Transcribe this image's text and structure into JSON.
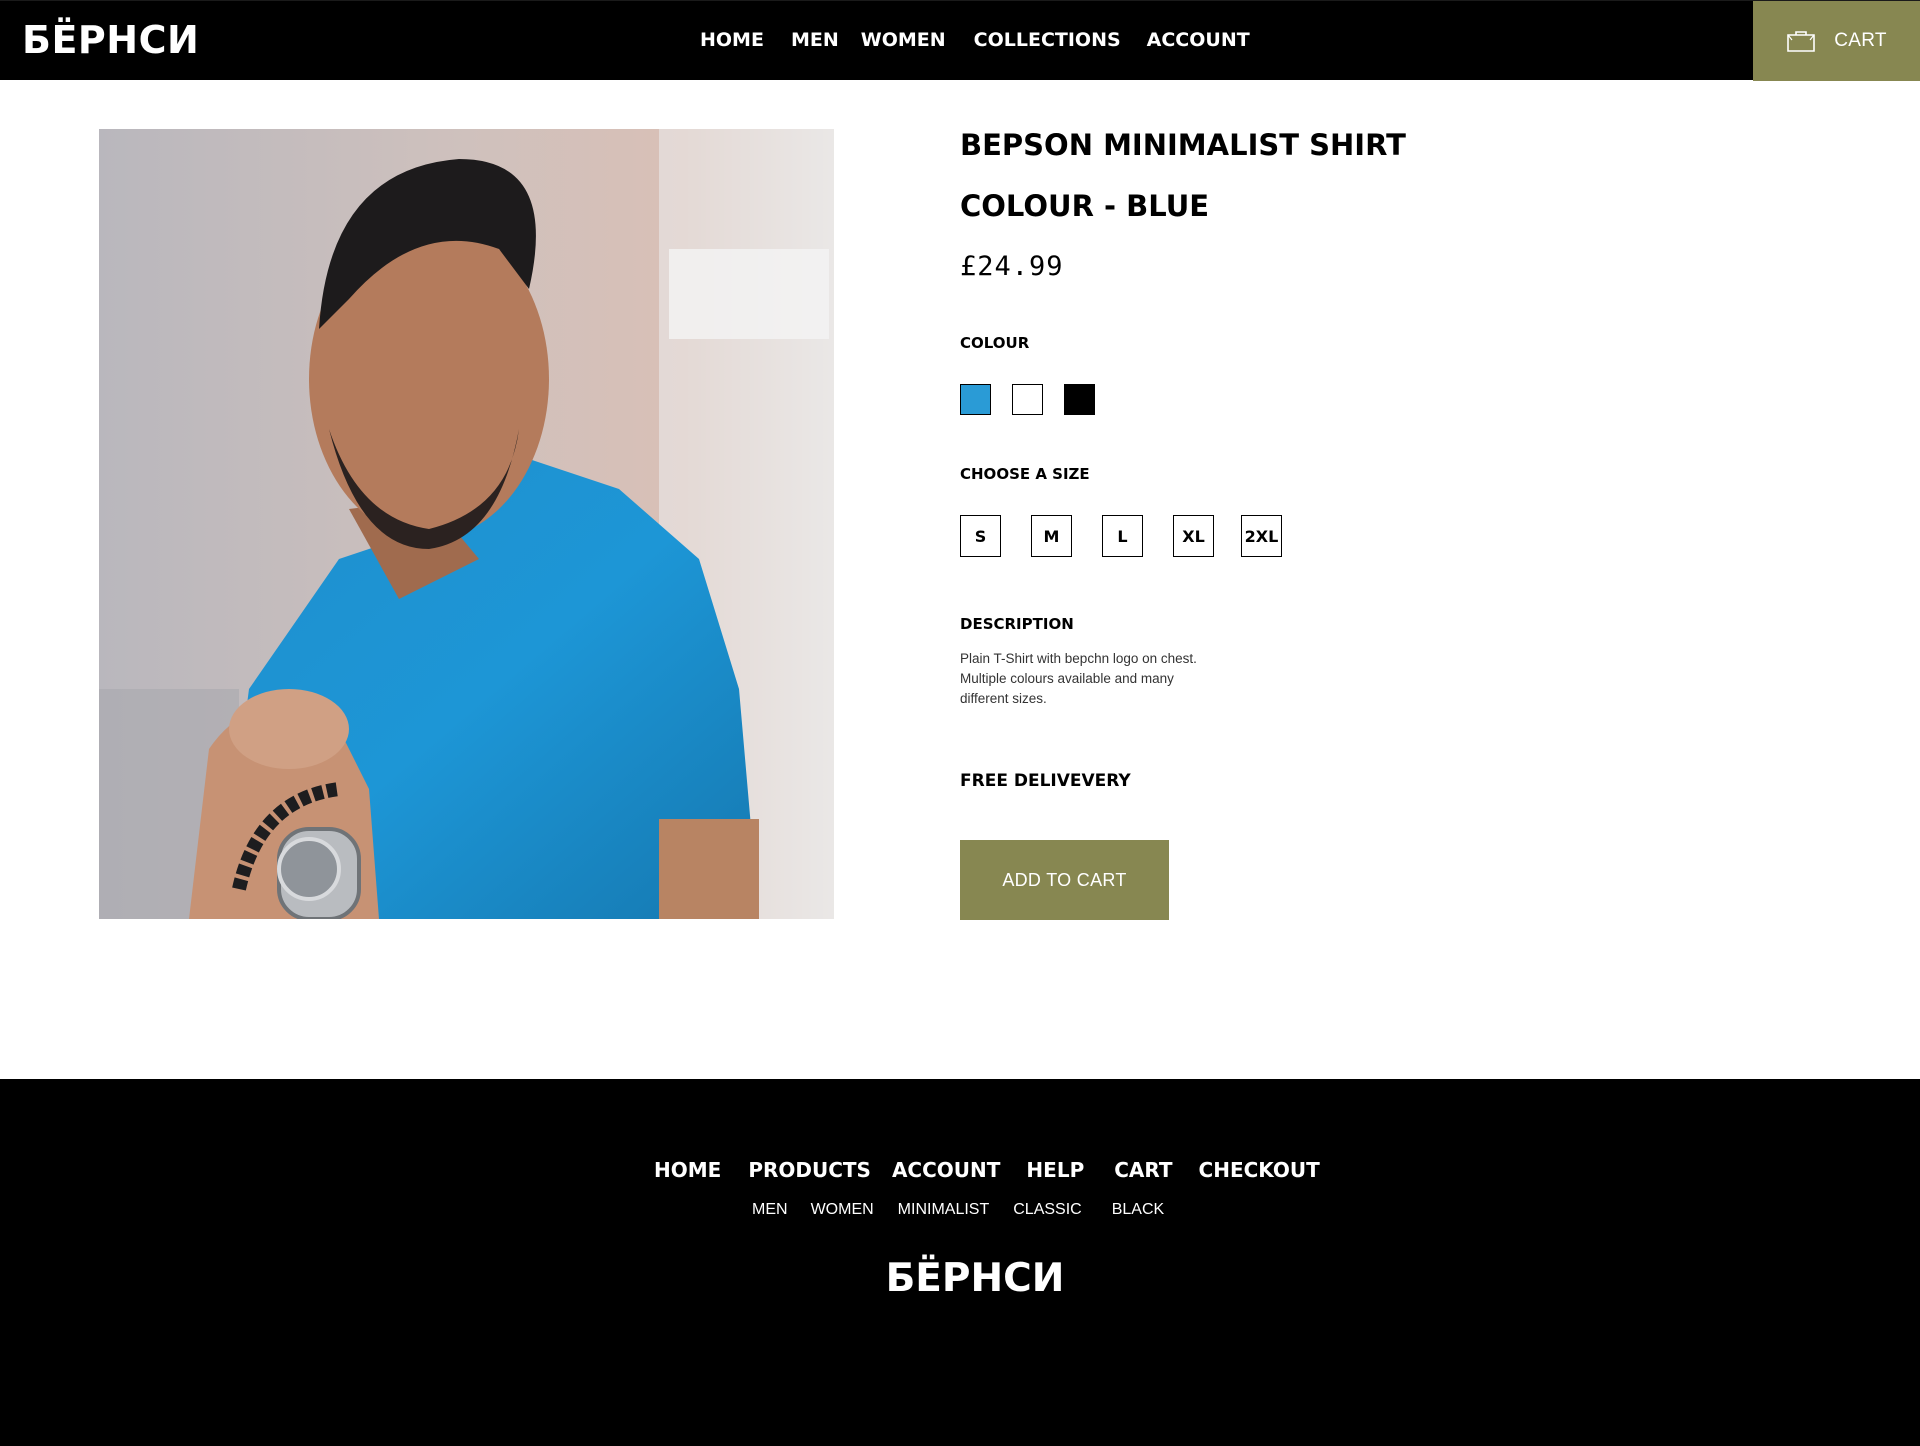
{
  "header": {
    "brand": "БЁРНСИ",
    "nav": [
      "HOME",
      "MEN",
      "WOMEN",
      "COLLECTIONS",
      "ACCOUNT"
    ],
    "cart_label": "CART",
    "cart_icon": "shopping-bag-icon"
  },
  "product": {
    "image_alt": "product-photo",
    "title": "BEPSON MINIMALIST SHIRT",
    "subtitle": "COLOUR - BLUE",
    "price": "£24.99",
    "colour_label": "COLOUR",
    "colours": [
      "#2a9bd6",
      "#ffffff",
      "#000000"
    ],
    "size_label": "CHOOSE A SIZE",
    "sizes": [
      "S",
      "M",
      "L",
      "XL",
      "2XL"
    ],
    "description_label": "DESCRIPTION",
    "description_lines": [
      "Plain T-Shirt with bepchn logo on chest.",
      "Multiple colours available and many",
      "different sizes."
    ],
    "delivery": "FREE DELIVEVERY",
    "add_to_cart": "ADD TO CART"
  },
  "footer": {
    "nav": [
      "HOME",
      "PRODUCTS",
      "ACCOUNT",
      "HELP",
      "CART",
      "CHECKOUT"
    ],
    "sub_nav": [
      "MEN",
      "WOMEN",
      "MINIMALIST",
      "CLASSIC",
      "BLACK"
    ],
    "brand": "БЁРНСИ"
  },
  "colors": {
    "accent": "#878751",
    "header_bg": "#000000",
    "footer_bg": "#000000"
  }
}
